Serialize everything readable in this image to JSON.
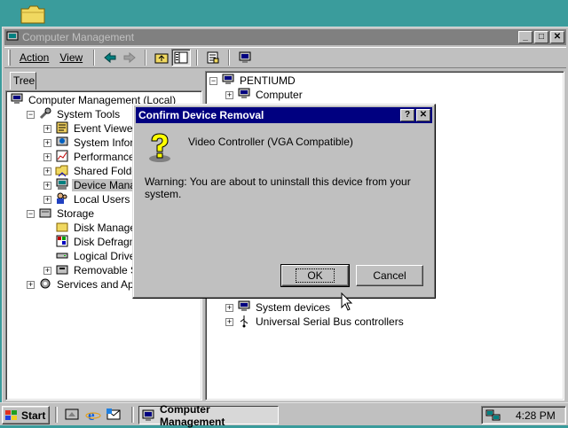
{
  "desktop": {
    "icon": "folder-icon"
  },
  "window": {
    "title": "Computer Management",
    "buttons": {
      "minimize": "_",
      "maximize": "□",
      "close": "✕"
    }
  },
  "toolbar": {
    "action": "Action",
    "view": "View",
    "icons": [
      "back-arrow-icon",
      "forward-arrow-icon",
      "up-folder-icon",
      "show-hide-tree-icon",
      "properties-icon",
      "scan-hardware-icon"
    ]
  },
  "left_pane": {
    "tab": "Tree",
    "items": [
      {
        "label": "Computer Management (Local)",
        "level": 0,
        "icon": "computer-icon"
      },
      {
        "label": "System Tools",
        "level": 1,
        "icon": "tools-icon"
      },
      {
        "label": "Event Viewer",
        "level": 2,
        "icon": "event-viewer-icon"
      },
      {
        "label": "System Information",
        "level": 2,
        "icon": "system-info-icon"
      },
      {
        "label": "Performance Logs",
        "level": 2,
        "icon": "performance-icon"
      },
      {
        "label": "Shared Folders",
        "level": 2,
        "icon": "shared-folder-icon"
      },
      {
        "label": "Device Manager",
        "level": 2,
        "icon": "device-manager-icon",
        "selected": true
      },
      {
        "label": "Local Users and G",
        "level": 2,
        "icon": "users-icon"
      },
      {
        "label": "Storage",
        "level": 1,
        "icon": "storage-icon"
      },
      {
        "label": "Disk Management",
        "level": 2,
        "icon": "disk-icon"
      },
      {
        "label": "Disk Defragmenter",
        "level": 2,
        "icon": "defrag-icon"
      },
      {
        "label": "Logical Drives",
        "level": 2,
        "icon": "drive-icon"
      },
      {
        "label": "Removable Stora",
        "level": 2,
        "icon": "removable-icon"
      },
      {
        "label": "Services and Applicat",
        "level": 1,
        "icon": "services-icon"
      }
    ]
  },
  "right_pane": {
    "items": [
      {
        "label": "PENTIUMD",
        "icon": "computer-icon"
      },
      {
        "label": "Computer",
        "icon": "computer-icon"
      },
      {
        "label": "System devices",
        "icon": "computer-icon"
      },
      {
        "label": "Universal Serial Bus controllers",
        "icon": "usb-icon"
      }
    ]
  },
  "dialog": {
    "title": "Confirm Device Removal",
    "help": "?",
    "close": "✕",
    "device": "Video Controller (VGA Compatible)",
    "warning": "Warning: You are about to uninstall this device from your system.",
    "ok": "OK",
    "cancel": "Cancel",
    "icon": "question-icon"
  },
  "taskbar": {
    "start": "Start",
    "task": "Computer Management",
    "time": "4:28 PM",
    "quicklaunch": [
      "show-desktop-icon",
      "internet-explorer-icon",
      "outlook-icon"
    ]
  }
}
